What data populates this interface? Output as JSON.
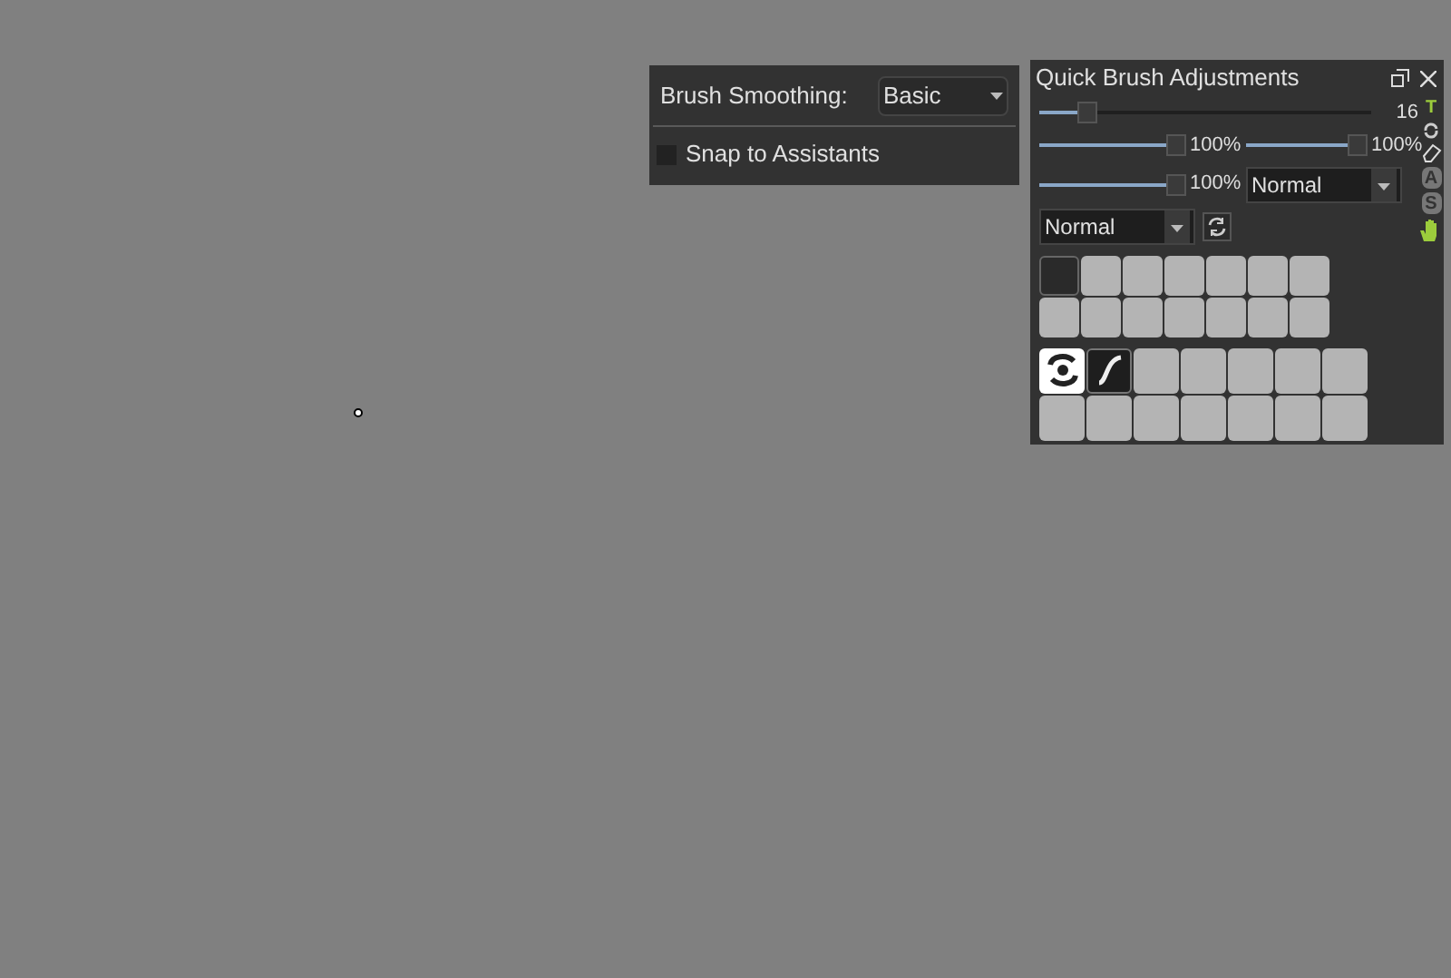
{
  "smoothing_panel": {
    "label": "Brush Smoothing:",
    "dropdown": {
      "value": "Basic"
    },
    "snap": {
      "label": "Snap to Assistants",
      "checked": false
    }
  },
  "quick_panel": {
    "title": "Quick Brush Adjustments",
    "size": {
      "level": 0.12,
      "reading": "16"
    },
    "sliders": [
      {
        "level": 1,
        "reading": "100%"
      },
      {
        "level": 1,
        "reading": "100%"
      },
      {
        "level": 1,
        "reading": "100%"
      }
    ],
    "blend_dropdown": {
      "value": "Normal"
    },
    "mode_dropdown": {
      "value": "Normal"
    },
    "side_tools": [
      {
        "kind": "letter",
        "label": "T",
        "on": true
      },
      {
        "kind": "cycle"
      },
      {
        "kind": "eraser"
      },
      {
        "kind": "letter",
        "label": "A",
        "on": false
      },
      {
        "kind": "letter",
        "label": "S",
        "on": false
      },
      {
        "kind": "hand"
      }
    ],
    "color_slots": [
      {
        "kind": "color",
        "color": "#2a2a2a"
      },
      {
        "kind": "empty"
      },
      {
        "kind": "empty"
      },
      {
        "kind": "empty"
      },
      {
        "kind": "empty"
      },
      {
        "kind": "empty"
      },
      {
        "kind": "empty"
      },
      {
        "kind": "empty"
      },
      {
        "kind": "empty"
      },
      {
        "kind": "empty"
      },
      {
        "kind": "empty"
      },
      {
        "kind": "empty"
      },
      {
        "kind": "empty"
      },
      {
        "kind": "empty"
      }
    ],
    "brush_slots": [
      {
        "kind": "swirl"
      },
      {
        "kind": "stroke"
      },
      {
        "kind": "empty"
      },
      {
        "kind": "empty"
      },
      {
        "kind": "empty"
      },
      {
        "kind": "empty"
      },
      {
        "kind": "empty"
      },
      {
        "kind": "empty"
      },
      {
        "kind": "empty"
      },
      {
        "kind": "empty"
      },
      {
        "kind": "empty"
      },
      {
        "kind": "empty"
      },
      {
        "kind": "empty"
      },
      {
        "kind": "empty"
      }
    ]
  }
}
